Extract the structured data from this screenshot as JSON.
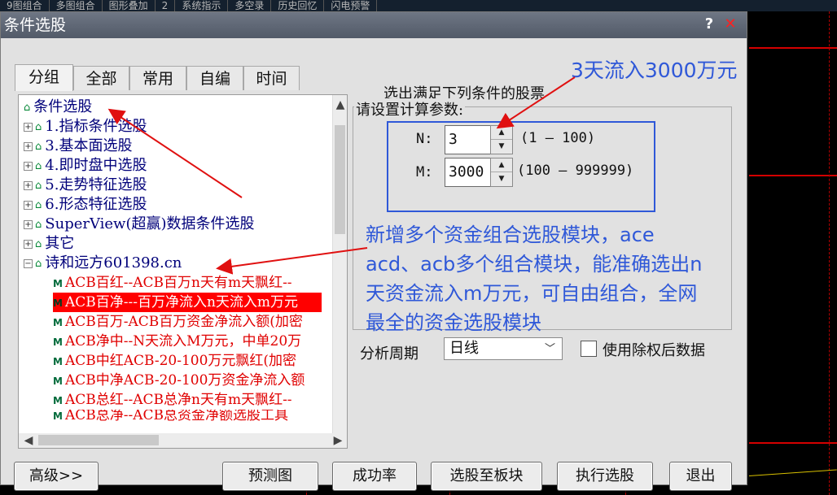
{
  "topbar": {
    "items": [
      "9图组合",
      "多图组合",
      "图形叠加",
      "2",
      "系统指示",
      "多空录",
      "历史回忆",
      "闪电预警"
    ]
  },
  "dialog": {
    "title": "条件选股",
    "help_label": "?",
    "close_label": "✕"
  },
  "tabs": [
    {
      "label": "分组"
    },
    {
      "label": "全部"
    },
    {
      "label": "常用"
    },
    {
      "label": "自编"
    },
    {
      "label": "时间"
    }
  ],
  "tree": {
    "root": "条件选股",
    "groups": [
      "1.指标条件选股",
      "3.基本面选股",
      "4.即时盘中选股",
      "5.走势特征选股",
      "6.形态特征选股",
      "SuperView(超赢)数据条件选股",
      "其它",
      "诗和远方601398.cn"
    ],
    "leaves": [
      "ACB百红--ACB百万n天有m天飘红--",
      "ACB百净---百万净流入n天流入m万元",
      "ACB百万-ACB百万资金净流入额(加密",
      "ACB净中--N天流入M万元，中单20万",
      "ACB中红ACB-20-100万元飘红(加密",
      "ACB中净ACB-20-100万资金净流入额",
      "ACB总红--ACB总净n天有m天飘红--",
      "ACB总净--ACB总资金净额选股工具"
    ],
    "selected_index": 1
  },
  "params": {
    "title": "选出满足下列条件的股票",
    "group_label": "请设置计算参数:",
    "n_label": "N:",
    "n_value": "3",
    "n_range": "(1 — 100)",
    "m_label": "M:",
    "m_value": "3000",
    "m_range": "(100 — 999999)"
  },
  "annotations": {
    "top": "3天流入3000万元",
    "body": "新增多个资金组合选股模块，ace acd、acb多个组合模块，能准确选出n天资金流入m万元，可自由组合，全网最全的资金选股模块",
    "color": "#2f58d8"
  },
  "period": {
    "label": "分析周期",
    "value": "日线",
    "checkbox_label": "使用除权后数据",
    "checked": false
  },
  "buttons": {
    "advanced": "高级>>",
    "forecast": "预测图",
    "success_rate": "成功率",
    "to_board": "选股至板块",
    "execute": "执行选股",
    "exit": "退出"
  },
  "colors": {
    "selected_row": "#ff0000",
    "leaf_text": "#e00000",
    "tree_text": "#00007a",
    "highlight_box": "#2f58d8"
  }
}
